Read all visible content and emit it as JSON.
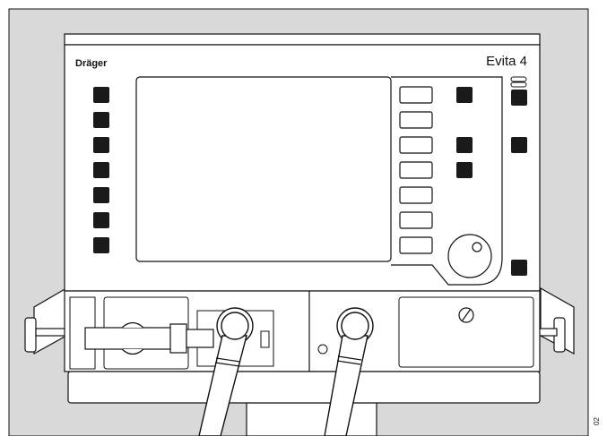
{
  "device": {
    "brand": "Dräger",
    "model": "Evita 4"
  },
  "figure": {
    "margin_code": "02"
  },
  "colors": {
    "background_panel": "#d9d9d9",
    "device_body": "#ffffff",
    "outline": "#111111",
    "key_fill": "#1a1a1a"
  },
  "icons": {
    "alarm_indicator": "alarm-light-icon",
    "rotary_knob": "rotary-knob-icon",
    "fuse_slot": "slotted-screw-icon"
  }
}
